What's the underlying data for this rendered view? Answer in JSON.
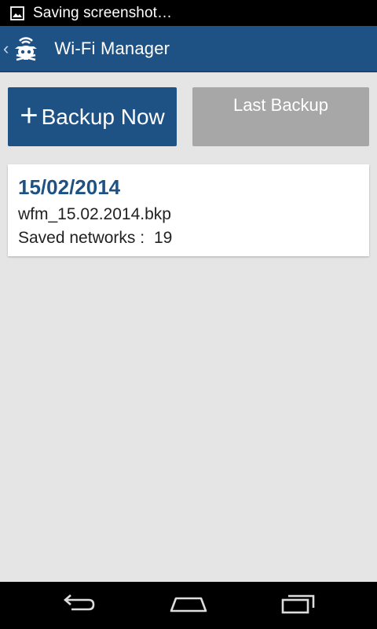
{
  "status_bar": {
    "notification_icon": "image-icon",
    "text": "Saving screenshot…"
  },
  "action_bar": {
    "up_icon": "back-caret-icon",
    "app_icon": "pirate-wifi-icon",
    "title": "Wi-Fi Manager",
    "color": "#1e5285"
  },
  "buttons": {
    "backup_now": {
      "icon": "plus-icon",
      "label": "Backup Now"
    },
    "last_backup": {
      "label": "Last Backup"
    }
  },
  "backup_list": [
    {
      "date": "15/02/2014",
      "filename": "wfm_15.02.2014.bkp",
      "networks_label": "Saved networks :",
      "networks_count": "19"
    }
  ],
  "nav_bar": {
    "back_icon": "back-icon",
    "home_icon": "home-icon",
    "recents_icon": "recents-icon"
  }
}
